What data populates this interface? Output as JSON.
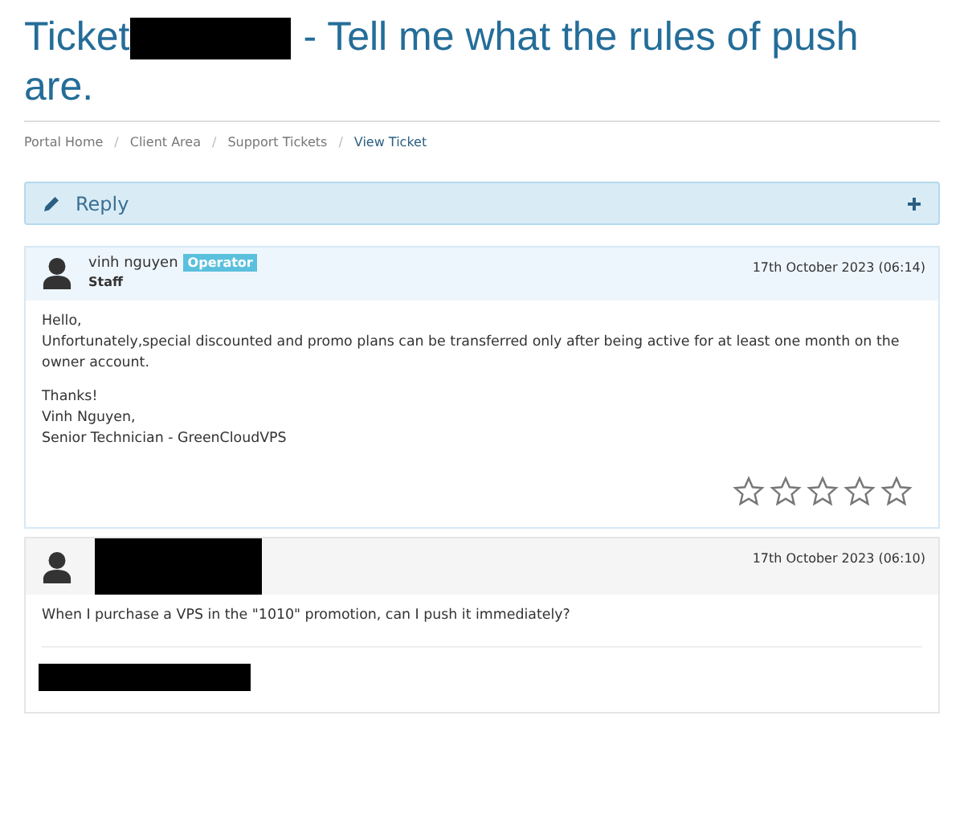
{
  "title": {
    "prefix": "Ticket",
    "suffix_lines": [
      "- Tell me what the rules of push",
      "are."
    ]
  },
  "breadcrumb_separator": "/",
  "breadcrumb": [
    {
      "label": "Portal Home",
      "selected": false
    },
    {
      "label": "Client Area",
      "selected": false
    },
    {
      "label": "Support Tickets",
      "selected": false
    },
    {
      "label": "View Ticket",
      "selected": true
    }
  ],
  "reply_panel": {
    "label": "Reply",
    "expanded": false
  },
  "messages": [
    {
      "kind": "staff",
      "author": "vinh nguyen",
      "badge": "Operator",
      "role": "Staff",
      "date": "17th October 2023 (06:14)",
      "paragraphs": [
        [
          "Hello,",
          "Unfortunately,special discounted and promo plans can be transferred only after being active for at least one month on the owner account."
        ],
        [
          "Thanks!",
          "Vinh Nguyen,",
          "Senior Technician - GreenCloudVPS"
        ]
      ],
      "stars": 0
    },
    {
      "kind": "client",
      "date": "17th October 2023 (06:10)",
      "paragraphs": [
        [
          "When I purchase a VPS in the \"1010\" promotion, can I push it immediately?"
        ]
      ]
    }
  ]
}
